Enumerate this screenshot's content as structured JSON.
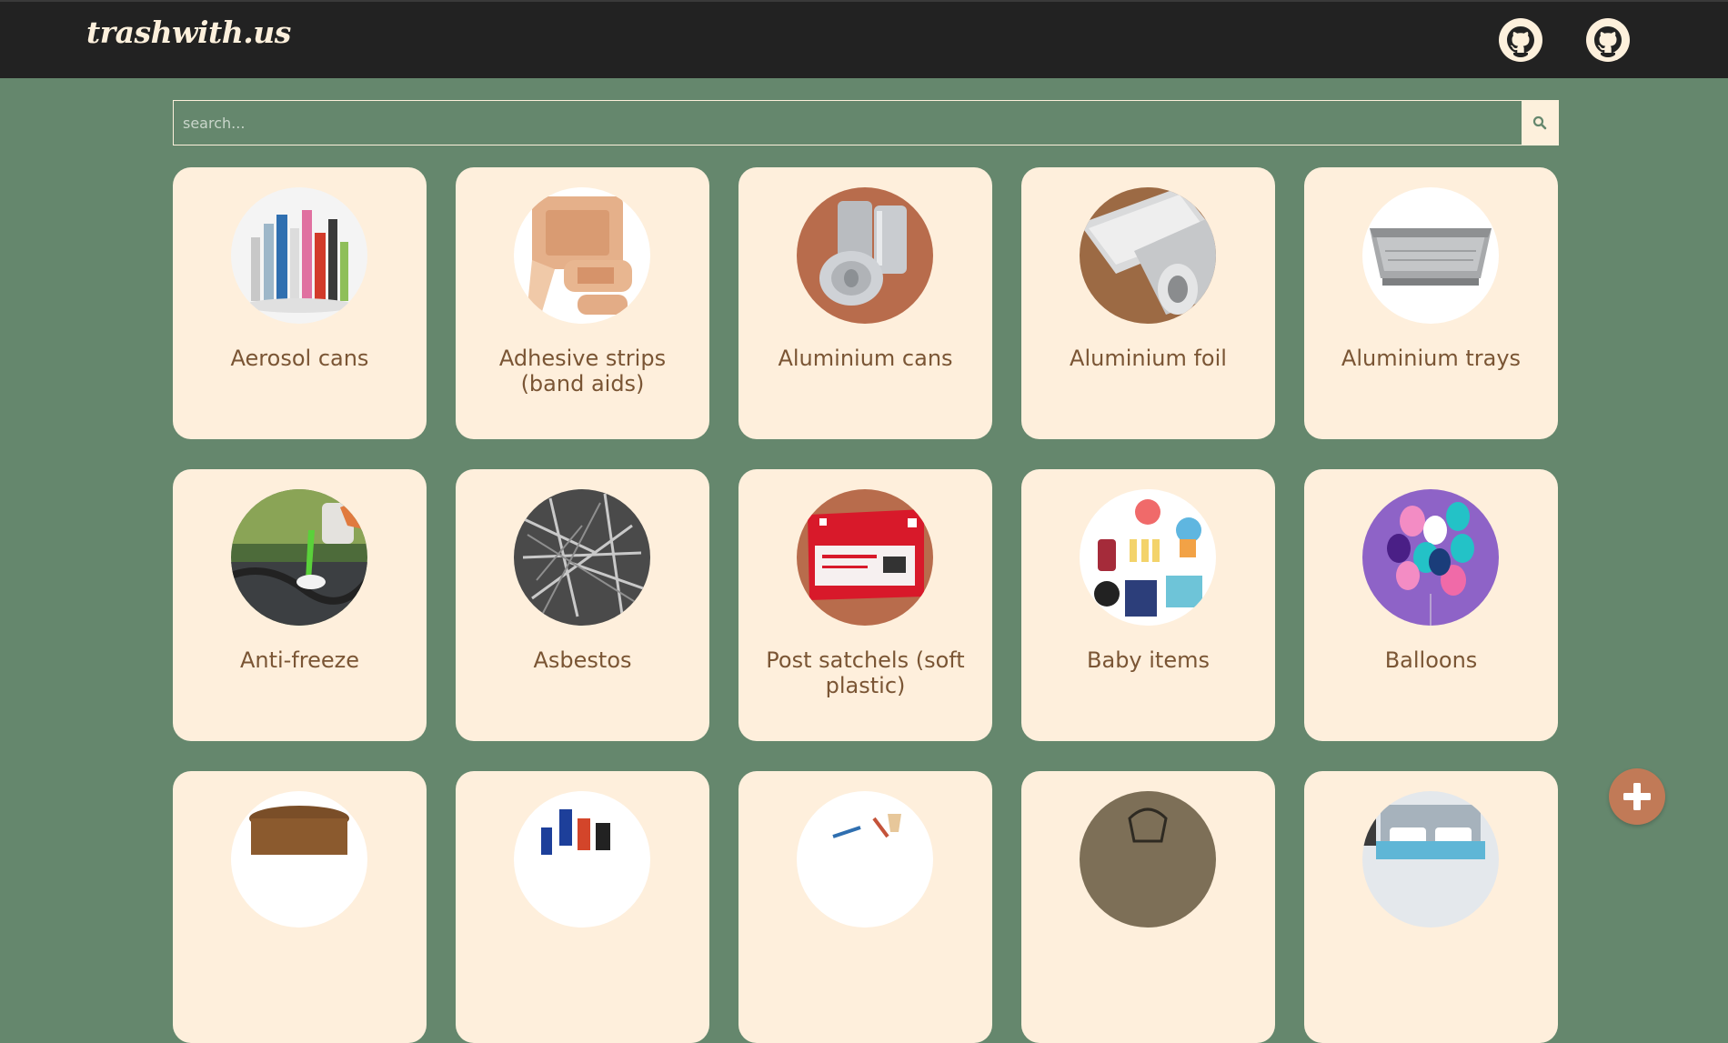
{
  "header": {
    "brand": "trashwith.us",
    "icons": [
      "github-icon",
      "github-icon"
    ]
  },
  "search": {
    "placeholder": "search...",
    "value": "",
    "button_icon": "search-icon"
  },
  "items": [
    {
      "label": "Aerosol cans"
    },
    {
      "label": "Adhesive strips (band aids)"
    },
    {
      "label": "Aluminium cans"
    },
    {
      "label": "Aluminium foil"
    },
    {
      "label": "Aluminium trays"
    },
    {
      "label": "Anti-freeze"
    },
    {
      "label": "Asbestos"
    },
    {
      "label": "Post satchels (soft plastic)"
    },
    {
      "label": "Baby items"
    },
    {
      "label": "Balloons"
    },
    {
      "label": ""
    },
    {
      "label": ""
    },
    {
      "label": ""
    },
    {
      "label": ""
    },
    {
      "label": ""
    }
  ],
  "fab": {
    "icon": "plus-icon"
  },
  "colors": {
    "background": "#65876d",
    "header": "#222222",
    "card": "#feefdc",
    "label": "#7a5534",
    "accent": "#c17a57"
  }
}
